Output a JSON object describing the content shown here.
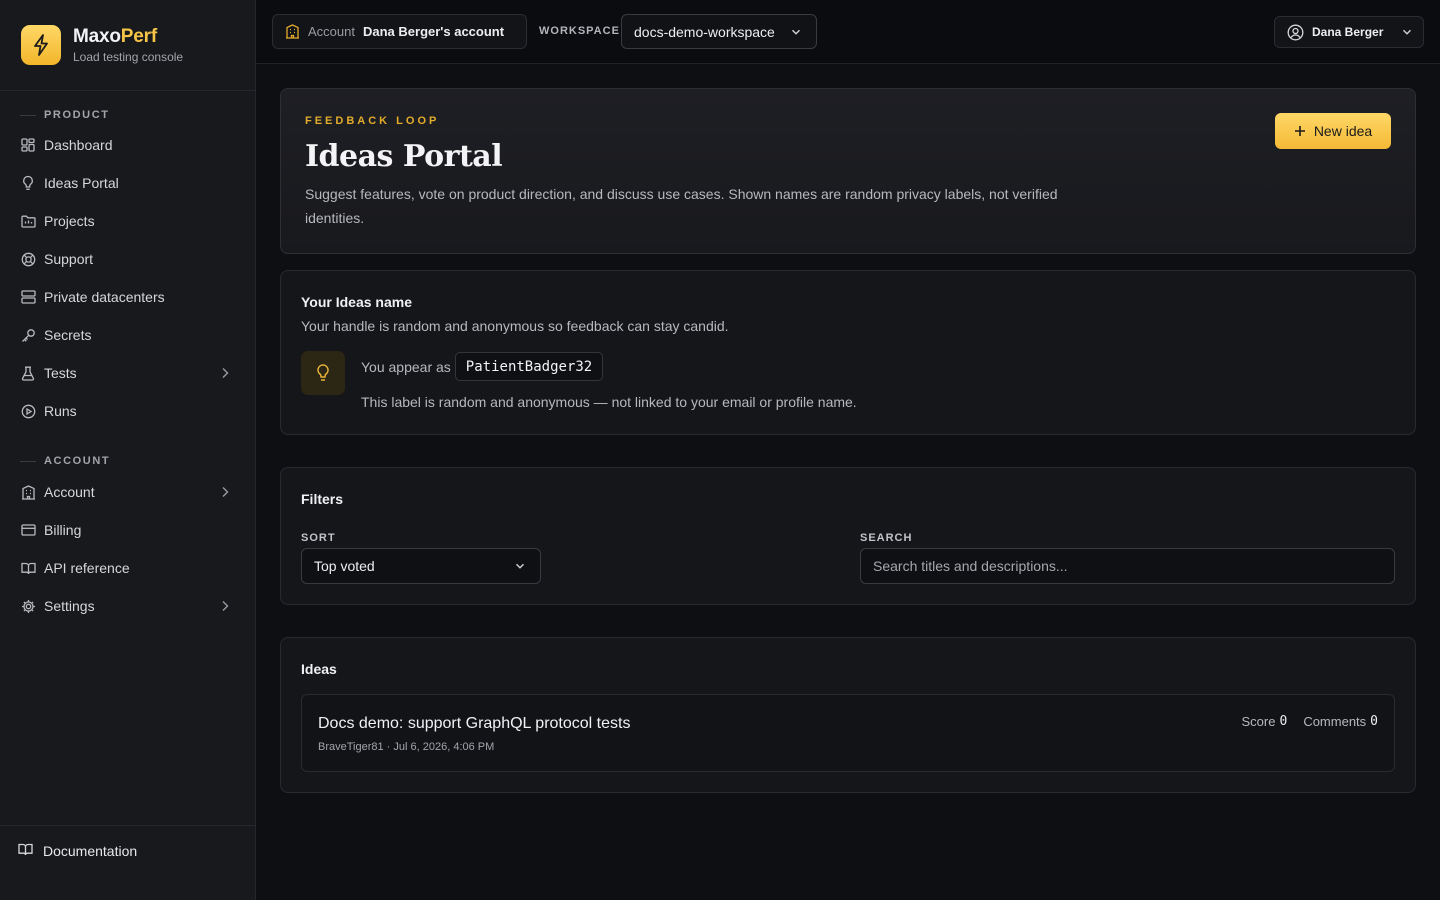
{
  "brand": {
    "name_part1": "Maxo",
    "name_part2": "Perf",
    "subtitle": "Load testing console",
    "logo_icon": "bolt-icon",
    "accent": "#f6c548"
  },
  "sidebar": {
    "product_label": "PRODUCT",
    "product_items": [
      {
        "label": "Dashboard",
        "icon": "dashboard-icon"
      },
      {
        "label": "Ideas Portal",
        "icon": "lightbulb-icon"
      },
      {
        "label": "Projects",
        "icon": "folder-icon"
      },
      {
        "label": "Support",
        "icon": "lifebuoy-icon"
      },
      {
        "label": "Private datacenters",
        "icon": "server-icon"
      },
      {
        "label": "Secrets",
        "icon": "key-icon"
      },
      {
        "label": "Tests",
        "icon": "flask-icon",
        "expandable": true
      },
      {
        "label": "Runs",
        "icon": "play-icon"
      }
    ],
    "account_label": "ACCOUNT",
    "account_items": [
      {
        "label": "Account",
        "icon": "building-icon",
        "expandable": true
      },
      {
        "label": "Billing",
        "icon": "credit-card-icon"
      },
      {
        "label": "API reference",
        "icon": "book-icon"
      },
      {
        "label": "Settings",
        "icon": "gear-icon",
        "expandable": true
      }
    ],
    "footer_label": "Documentation"
  },
  "topbar": {
    "account_label": "Account",
    "account_value": "Dana Berger's account",
    "workspace_label": "WORKSPACE",
    "workspace_value": "docs-demo-workspace",
    "user_name": "Dana Berger"
  },
  "hero": {
    "eyebrow": "FEEDBACK LOOP",
    "title": "Ideas Portal",
    "description": "Suggest features, vote on product direction, and discuss use cases. Shown names are random privacy labels, not verified identities.",
    "new_idea_label": "New idea"
  },
  "identity": {
    "title": "Your Ideas name",
    "subtitle": "Your handle is random and anonymous so feedback can stay candid.",
    "appear_prefix": "You appear as",
    "handle": "PatientBadger32",
    "note": "This label is random and anonymous — not linked to your email or profile name."
  },
  "filters": {
    "title": "Filters",
    "sort_label": "SORT",
    "sort_value": "Top voted",
    "search_label": "SEARCH",
    "search_placeholder": "Search titles and descriptions..."
  },
  "ideas": {
    "title": "Ideas",
    "items": [
      {
        "title": "Docs demo: support GraphQL protocol tests",
        "meta": "BraveTiger81 · Jul 6, 2026, 4:06 PM",
        "score_label": "Score",
        "score": "0",
        "comments_label": "Comments",
        "comments": "0"
      }
    ]
  }
}
